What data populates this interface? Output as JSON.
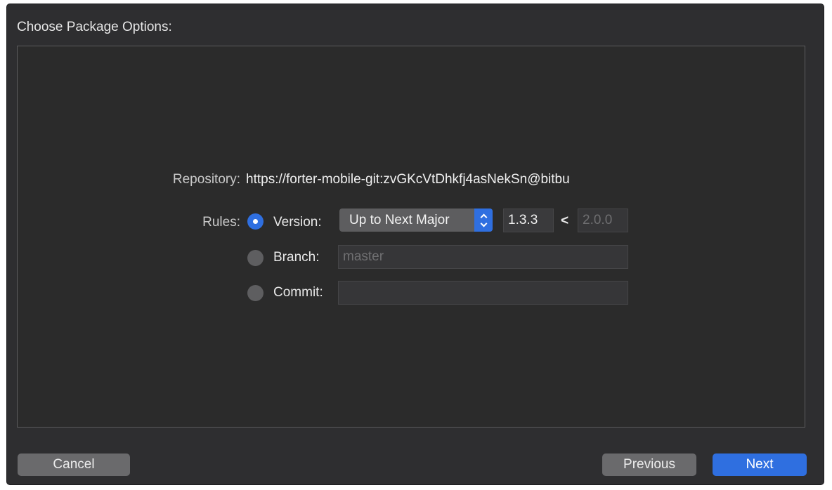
{
  "sheet": {
    "title": "Choose Package Options:"
  },
  "repository": {
    "label": "Repository:",
    "value": "https://forter-mobile-git:zvGKcVtDhkfj4asNekSn@bitbu"
  },
  "rules": {
    "label": "Rules:",
    "version": {
      "label": "Version:",
      "selected": true,
      "mode": "Up to Next Major",
      "lower": "1.3.3",
      "separator": "<",
      "upper": "2.0.0"
    },
    "branch": {
      "label": "Branch:",
      "selected": false,
      "placeholder": "master"
    },
    "commit": {
      "label": "Commit:",
      "selected": false,
      "value": ""
    }
  },
  "buttons": {
    "cancel": "Cancel",
    "previous": "Previous",
    "next": "Next"
  },
  "colors": {
    "accent": "#2f6fe0",
    "background": "#2e2e30"
  },
  "icons": {
    "popup_arrows": "chevron-up-down-icon"
  }
}
